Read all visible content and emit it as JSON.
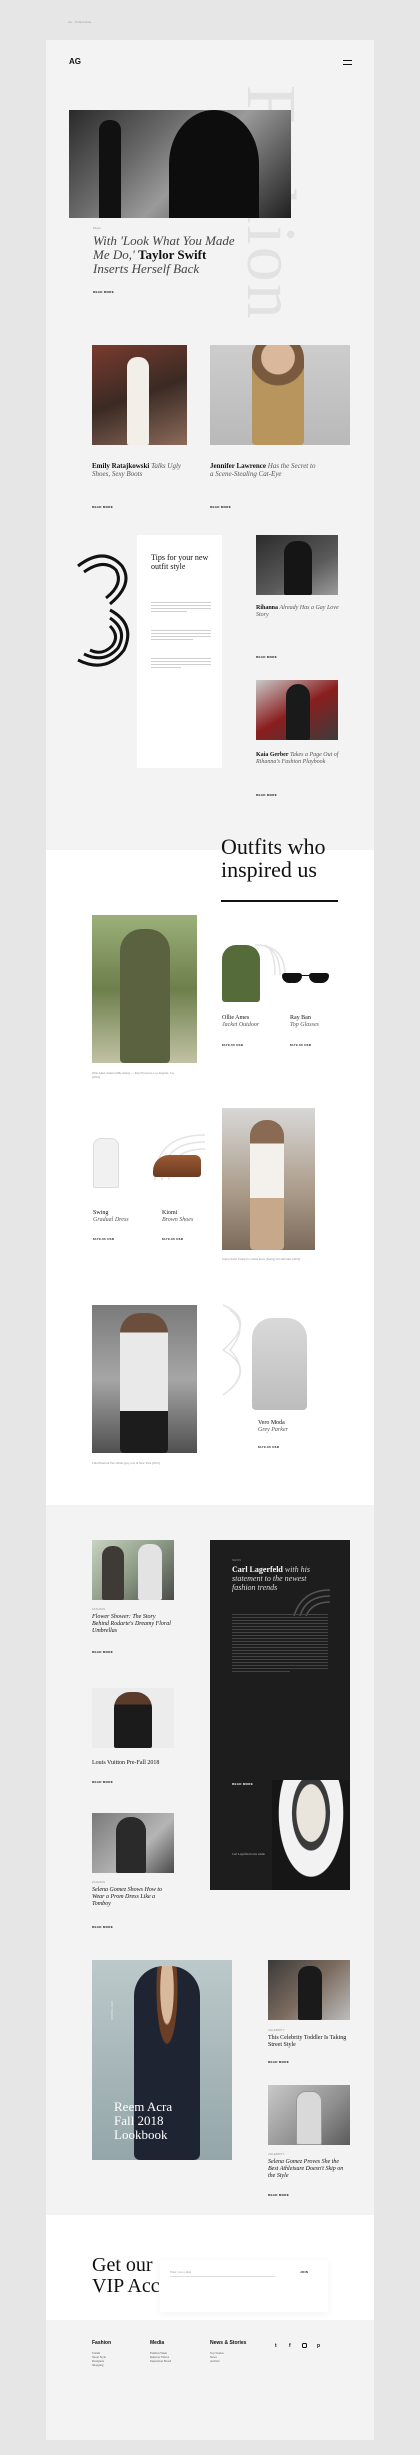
{
  "browser": {
    "title": "AG - Fashion Issue"
  },
  "header": {
    "logo": "AG",
    "menu_icon": "hamburger-icon"
  },
  "hero": {
    "watermark": "Fashion",
    "tag": "Music",
    "title_italic_1": "With 'Look What You Made Me Do,'",
    "title_bold_1": "Taylor Swift",
    "title_italic_2": "Inserts Herself Back",
    "read_more": "READ MORE"
  },
  "cards_row": [
    {
      "name": "Emily Ratajkowski",
      "desc": "Talks Ugly Shoes, Sexy Boots",
      "more": "READ MORE"
    },
    {
      "name": "Jennifer Lawrence",
      "desc": "Has the Secret to a Scene-Stealing Cat-Eye",
      "more": "READ MORE"
    }
  ],
  "tips": {
    "number": "3",
    "title": "Tips for your new outfit style",
    "items": [
      "1",
      "2",
      "3"
    ]
  },
  "side_stories": [
    {
      "name": "Rihanna",
      "desc": "Already Has a Gay Love Story",
      "more": "READ MORE"
    },
    {
      "name": "Kaia Gerber",
      "desc": "Takes a Page Out of Rihanna's Fashion Playbook",
      "more": "READ MORE"
    }
  ],
  "outfits": {
    "heading": "Outfits who inspired us",
    "caption_1": "Ollie Ames Jacket (Ollie Ames) — Rays Eyewear, Los Angeles, CA (2019)",
    "products_1": [
      {
        "name": "Ollie Ames",
        "desc": "Jacket Outdoor",
        "price": "$179.00 USD"
      },
      {
        "name": "Ray Ban",
        "desc": "Top Glasses",
        "price": "$179.00 USD"
      }
    ],
    "products_2": [
      {
        "name": "Swing",
        "desc": "Gradual Dress",
        "price": "$179.00 USD"
      },
      {
        "name": "Kiomi",
        "desc": "Brown Shoes",
        "price": "$179.00 USD"
      }
    ],
    "caption_2": "Taylor Swift Swing in a white dress (Swing) in California (2019)",
    "product_3": {
      "name": "Vero Moda",
      "desc": "Grey Parker",
      "price": "$179.00 USD"
    },
    "caption_3": "Lilia Hereford Vero Moda grey coat in New York (2019)"
  },
  "more_section": {
    "left_items": [
      {
        "tag": "FASHION",
        "title": "Flower Shower: The Story Behind Rodarte's Dreamy Floral Umbrellas",
        "more": "READ MORE"
      },
      {
        "tag": "",
        "title": "Louis Vuitton Pre-Fall 2018",
        "more": "READ MORE"
      },
      {
        "tag": "FASHION",
        "title": "Selena Gomez Shows How to Wear a Prom Dress Like a Tomboy",
        "more": "READ MORE"
      }
    ],
    "feature": {
      "tag": "NEWS",
      "title_bold": "Carl Lagerfeld",
      "title_rest": "with his statement to the newest fashion trends",
      "more": "READ MORE",
      "quote": "Carl Lagerfeld in the studio"
    }
  },
  "lookbook": {
    "subtitle": "SPRING 2018",
    "title_1": "Reem Acra",
    "title_2": "Fall 2018",
    "title_3": "Lookbook",
    "side": [
      {
        "tag": "CELEBRITY",
        "title": "This Celebrity Toddler Is Taking Street Style",
        "more": "READ MORE"
      },
      {
        "tag": "CELEBRITY",
        "title": "Selena Gomez Proves She the Best Athleisure Doesn't Skip on the Style",
        "more": "READ MORE"
      }
    ]
  },
  "vip": {
    "title_1": "Get our",
    "title_2": "VIP Access",
    "placeholder": "Enter your e-mail",
    "button": "JOIN"
  },
  "footer": {
    "cols": [
      {
        "title": "Fashion",
        "items": [
          "Trends",
          "Street Style",
          "Designers",
          "Shopping"
        ]
      },
      {
        "title": "Media",
        "items": [
          "Fashion Week",
          "Runway Videos",
          "Inspiration Board"
        ]
      },
      {
        "title": "News & Stories",
        "items": [
          "Top Stories",
          "News",
          "Archive"
        ]
      }
    ],
    "social": [
      "twitter-icon",
      "facebook-icon",
      "instagram-icon",
      "pinterest-icon"
    ]
  }
}
